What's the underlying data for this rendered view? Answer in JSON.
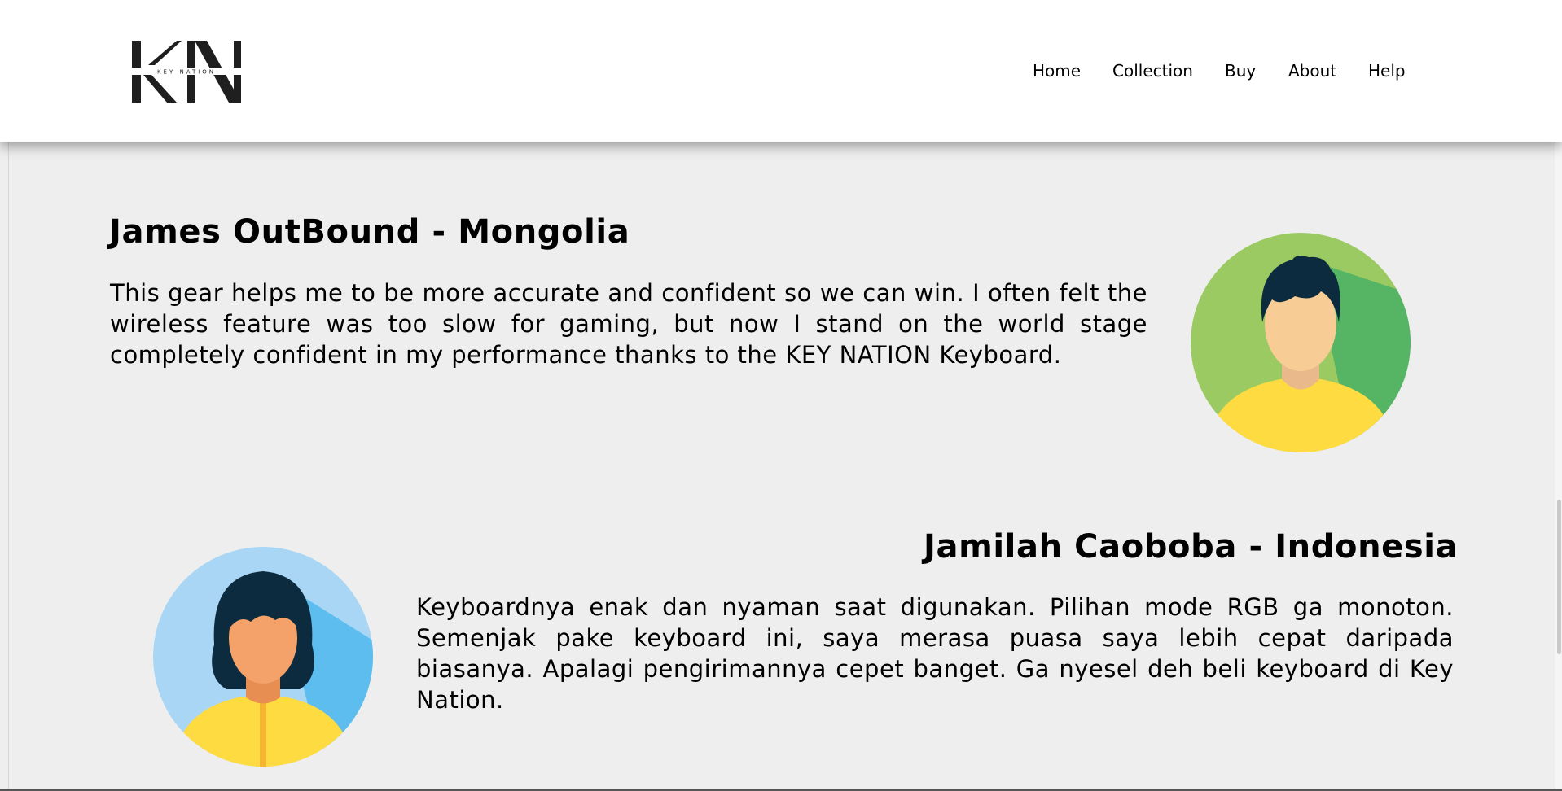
{
  "header": {
    "logo_text": "KEY NATION",
    "nav": [
      "Home",
      "Collection",
      "Buy",
      "About",
      "Help"
    ]
  },
  "testimonials": [
    {
      "name": "James OutBound - Mongolia",
      "quote": "This gear helps me to be more accurate and confident so we can win. I often felt the wireless feature was too slow for gaming, but now I stand on the world stage completely confident in my performance thanks to the KEY NATION Keyboard.",
      "avatar": "male-user-avatar-icon"
    },
    {
      "name": "Jamilah Caoboba - Indonesia",
      "quote": "Keyboardnya enak dan nyaman saat digunakan. Pilihan mode RGB ga monoton. Semenjak pake keyboard ini, saya merasa puasa saya lebih cepat daripada biasanya. Apalagi pengirimannya cepet banget. Ga nyesel deh beli keyboard di Key Nation.",
      "avatar": "female-user-avatar-icon"
    }
  ],
  "colors": {
    "header_bg": "#ffffff",
    "page_bg": "#eeeeee",
    "text": "#000000",
    "avatar1_circle": "#9bc962",
    "avatar1_shadow": "#56b565",
    "avatar2_circle": "#a8d6f4",
    "avatar2_shadow": "#5cbdee",
    "shirt": "#fedb41",
    "hair": "#0d2b3e"
  }
}
